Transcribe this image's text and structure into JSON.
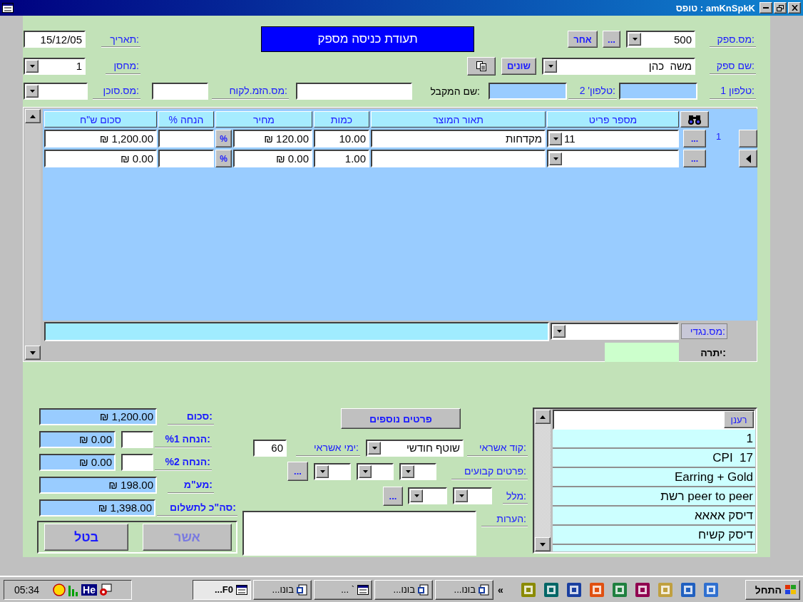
{
  "window": {
    "title": "טופס : amKnSpkK"
  },
  "header": {
    "form_title": "תעודת כניסה מספק",
    "date": {
      "label": "תאריך:",
      "value": "15/12/05"
    },
    "warehouse": {
      "label": "מחסן:",
      "value": "1"
    },
    "agent": {
      "label": "מס.סוכן:"
    },
    "customer_order": {
      "label": "מס.הזמ.לקוח:"
    },
    "recipient": {
      "label": "שם המקבל:"
    },
    "phone2": {
      "label": "טלפון' 2:"
    },
    "phone1": {
      "label": "טלפון 1:"
    },
    "supplier_no": {
      "label": "מס.ספק:",
      "value": "500",
      "browse_button": "...",
      "other_button": "אחר"
    },
    "supplier_name": {
      "label": "שם ספק:",
      "value": "משה  כהן",
      "misc_button": "שונים"
    }
  },
  "grid": {
    "columns": [
      "מספר פריט",
      "תאור המוצר",
      "כמות",
      "מחיר",
      "% הנחה",
      "סכום ש\"ח"
    ],
    "rows": [
      {
        "total": "₪ 1,200.00",
        "percent_button": "%",
        "price": "₪ 120.00",
        "quantity": "10.00",
        "description": "מקדחות",
        "item_no": "11",
        "browse_button": "...",
        "record_no": "1",
        "current": false
      },
      {
        "total": "₪ 0.00",
        "percent_button": "%",
        "price": "₪ 0.00",
        "quantity": "1.00",
        "browse_button": "...",
        "current": true
      }
    ],
    "counter_account": {
      "label": "מס.נגדי:"
    },
    "balance": {
      "label": "יתרה:"
    }
  },
  "totals": [
    {
      "label": "סכום:",
      "value": "₪ 1,200.00",
      "kind": "amount"
    },
    {
      "label": "%הנחה 1:",
      "value": "₪ 0.00",
      "kind": "discount"
    },
    {
      "label": "%הנחה 2:",
      "value": "₪ 0.00",
      "kind": "discount"
    },
    {
      "label": "מע\"מ:",
      "value": "₪ 198.00",
      "kind": "amount"
    },
    {
      "label": "סה\"כ לתשלום:",
      "value": "₪ 1,398.00",
      "kind": "grand"
    }
  ],
  "actions": [
    {
      "label": "אשר",
      "disabled": true
    },
    {
      "label": "בטל",
      "disabled": false
    }
  ],
  "details": {
    "more_button": "פרטים נוספים",
    "credit_code": {
      "label": "קוד אשראי:",
      "value": "שוטף חודשי"
    },
    "credit_days": {
      "label": "ימי אשראי:",
      "value": "60"
    },
    "fixed_items": {
      "label": "פרטים קבועים:",
      "browse_button": "..."
    },
    "general_text": {
      "label": "מלל:",
      "browse_button": "..."
    },
    "notes": {
      "label": "הערות:"
    }
  },
  "item_list": {
    "refresh_button": "רענן",
    "items": [
      "1",
      "CPI  17",
      "Earring + Gold",
      "רשת peer to peer",
      "דיסק אאאא",
      "דיסק קשיח"
    ]
  },
  "taskbar": {
    "clock": "05:34",
    "language": "He",
    "overflow": "«",
    "start_button": "התחל",
    "tasks": [
      {
        "label": "בונו...",
        "kind": "document",
        "selected": false
      },
      {
        "label": "בונו...",
        "kind": "document",
        "selected": false
      },
      {
        "label": "` ...",
        "kind": "form",
        "selected": false
      },
      {
        "label": "בונו...",
        "kind": "document",
        "selected": false
      },
      {
        "label": "F0...",
        "kind": "form",
        "selected": true
      }
    ]
  }
}
